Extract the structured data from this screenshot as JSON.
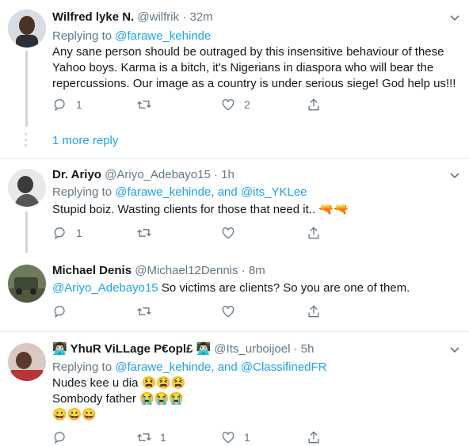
{
  "icons": {
    "reply": "reply-icon",
    "retweet": "retweet-icon",
    "like": "heart-icon",
    "share": "share-icon",
    "caret": "chevron-down-icon"
  },
  "colors": {
    "link": "#1da1f2",
    "muted": "#657786",
    "line": "#ccd6dd"
  },
  "tweets": [
    {
      "name": "Wilfred lyke N.",
      "handle": "@wilfrik",
      "dot": "·",
      "time": "32m",
      "replying": "Replying to",
      "mentions": "@farawe_kehinde",
      "text": "Any sane person should be outraged by this insensitive behaviour of these Yahoo boys. Karma is a bitch, it's Nigerians in diaspora who will bear the repercussions. Our image as a country is under serious siege! God help us!!!",
      "replies": "1",
      "retweets": "",
      "likes": "2"
    },
    {
      "more_replies": "1 more reply"
    },
    {
      "name": "Dr. Ariyo",
      "handle": "@Ariyo_Adebayo15",
      "dot": "·",
      "time": "1h",
      "replying": "Replying to",
      "mentions": "@farawe_kehinde, and @its_YKLee",
      "text": "Stupid boiz. Wasting clients for those that need it.. 🔫🔫",
      "replies": "1",
      "retweets": "",
      "likes": ""
    },
    {
      "name": "Michael Denis",
      "handle": "@Michael12Dennis",
      "dot": "·",
      "time": "8m",
      "mention": "@Ariyo_Adebayo15",
      "text": " So victims are clients? So you are one of them.",
      "replies": "",
      "retweets": "",
      "likes": ""
    },
    {
      "name": "👨🏻‍💻 YhuR ViLLage P€opl£ 👨🏻‍💻",
      "handle": "@Its_urboijoel",
      "dot": "·",
      "time": "5h",
      "replying": "Replying to",
      "mentions": "@farawe_kehinde, and @ClassifinedFR",
      "line1": "Nudes kee u dia 😫😫😫",
      "line2": "Sombody father 😭😭😭",
      "line3": "😀😀😀",
      "replies": "",
      "retweets": "1",
      "likes": "1"
    }
  ]
}
